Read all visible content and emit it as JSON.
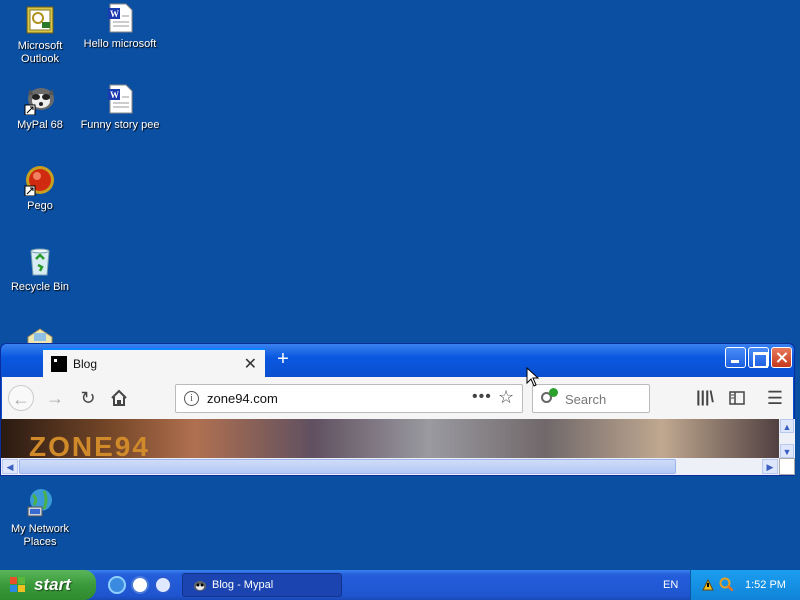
{
  "desktop": {
    "icons": [
      {
        "label": "Microsoft Outlook"
      },
      {
        "label": "Hello microsoft"
      },
      {
        "label": "MyPal 68"
      },
      {
        "label": "Funny story pee"
      },
      {
        "label": "Pego"
      },
      {
        "label": "Recycle Bin"
      },
      {
        "label": "My Network Places"
      }
    ]
  },
  "browser": {
    "tab_title": "Blog",
    "tab_close": "✕",
    "new_tab": "+",
    "url": "zone94.com",
    "url_more": "•••",
    "url_star": "☆",
    "search_placeholder": "Search",
    "page_brand": "ZONE94"
  },
  "taskbar": {
    "start_label": "start",
    "task_label": "Blog - Mypal",
    "language": "EN",
    "clock": "1:52 PM"
  }
}
